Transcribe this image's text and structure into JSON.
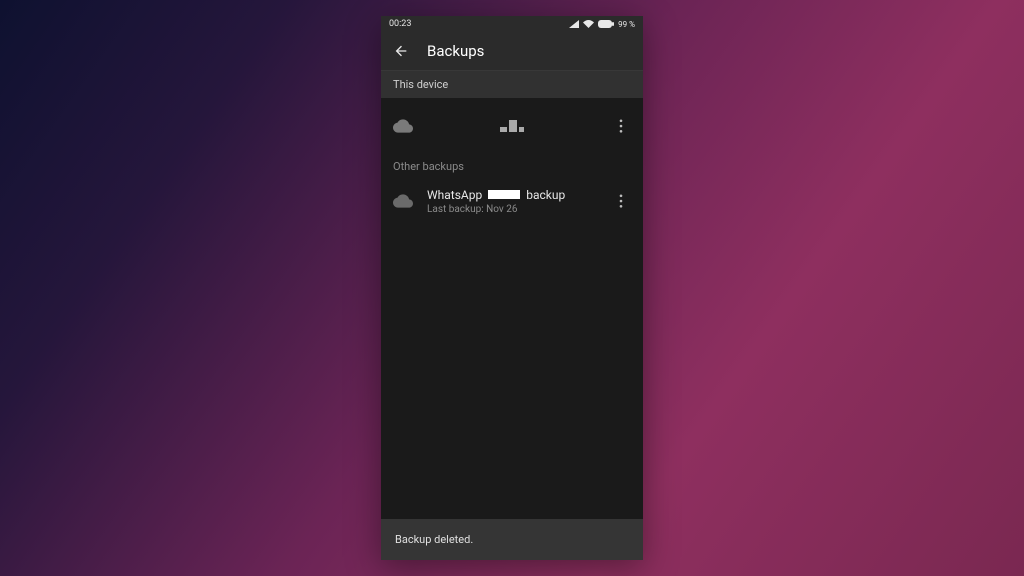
{
  "status": {
    "time": "00:23",
    "battery": "99 %"
  },
  "header": {
    "title": "Backups"
  },
  "sections": {
    "thisDevice": "This device",
    "otherBackups": "Other backups"
  },
  "backups": {
    "device": {
      "title_prefix": ""
    },
    "whatsapp": {
      "title_prefix": "WhatsApp",
      "title_suffix": "backup",
      "subtitle": "Last backup: Nov 26"
    }
  },
  "snackbar": {
    "message": "Backup deleted."
  }
}
